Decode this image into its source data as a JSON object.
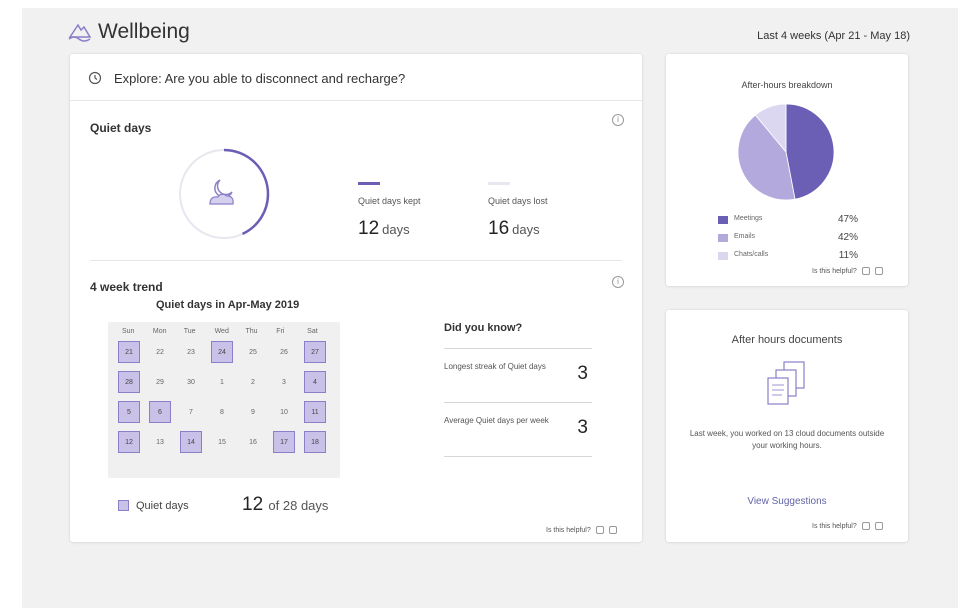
{
  "header": {
    "title": "Wellbeing",
    "date_range": "Last 4 weeks (Apr 21 - May 18)"
  },
  "explore": {
    "text": "Explore: Are you able to disconnect and recharge?"
  },
  "quiet_days": {
    "title": "Quiet days",
    "kept_label": "Quiet days kept",
    "kept_value": "12",
    "kept_unit": "days",
    "lost_label": "Quiet days lost",
    "lost_value": "16",
    "lost_unit": "days",
    "ring_fraction": 0.43,
    "accent": "#6b5fb5"
  },
  "trend": {
    "title": "4 week trend",
    "calendar_title": "Quiet days in Apr-May 2019",
    "weekdays": [
      "Sun",
      "Mon",
      "Tue",
      "Wed",
      "Thu",
      "Fri",
      "Sat"
    ],
    "days": [
      {
        "d": "21",
        "quiet": true
      },
      {
        "d": "22",
        "quiet": false
      },
      {
        "d": "23",
        "quiet": false
      },
      {
        "d": "24",
        "quiet": true
      },
      {
        "d": "25",
        "quiet": false
      },
      {
        "d": "26",
        "quiet": false
      },
      {
        "d": "27",
        "quiet": true
      },
      {
        "d": "28",
        "quiet": true
      },
      {
        "d": "29",
        "quiet": false
      },
      {
        "d": "30",
        "quiet": false
      },
      {
        "d": "1",
        "quiet": false
      },
      {
        "d": "2",
        "quiet": false
      },
      {
        "d": "3",
        "quiet": false
      },
      {
        "d": "4",
        "quiet": true
      },
      {
        "d": "5",
        "quiet": true
      },
      {
        "d": "6",
        "quiet": true
      },
      {
        "d": "7",
        "quiet": false
      },
      {
        "d": "8",
        "quiet": false
      },
      {
        "d": "9",
        "quiet": false
      },
      {
        "d": "10",
        "quiet": false
      },
      {
        "d": "11",
        "quiet": true
      },
      {
        "d": "12",
        "quiet": true
      },
      {
        "d": "13",
        "quiet": false
      },
      {
        "d": "14",
        "quiet": true
      },
      {
        "d": "15",
        "quiet": false
      },
      {
        "d": "16",
        "quiet": false
      },
      {
        "d": "17",
        "quiet": true
      },
      {
        "d": "18",
        "quiet": true
      }
    ],
    "legend_label": "Quiet days",
    "count_value": "12",
    "count_suffix": "of 28 days"
  },
  "did_you_know": {
    "title": "Did you know?",
    "rows": [
      {
        "label": "Longest streak of Quiet days",
        "value": "3"
      },
      {
        "label": "Average Quiet days per week",
        "value": "3"
      }
    ]
  },
  "helpful": {
    "text": "Is this helpful?"
  },
  "after_hours": {
    "title": "After-hours breakdown",
    "slices": [
      {
        "name": "Meetings",
        "pct": "47%",
        "value": 47,
        "color": "#6b5fb5"
      },
      {
        "name": "Emails",
        "pct": "42%",
        "value": 42,
        "color": "#b3a9dd"
      },
      {
        "name": "Chats/calls",
        "pct": "11%",
        "value": 11,
        "color": "#dcd7f0"
      }
    ]
  },
  "documents": {
    "title": "After hours documents",
    "text": "Last week, you worked on 13 cloud documents outside your working hours.",
    "link": "View Suggestions"
  }
}
